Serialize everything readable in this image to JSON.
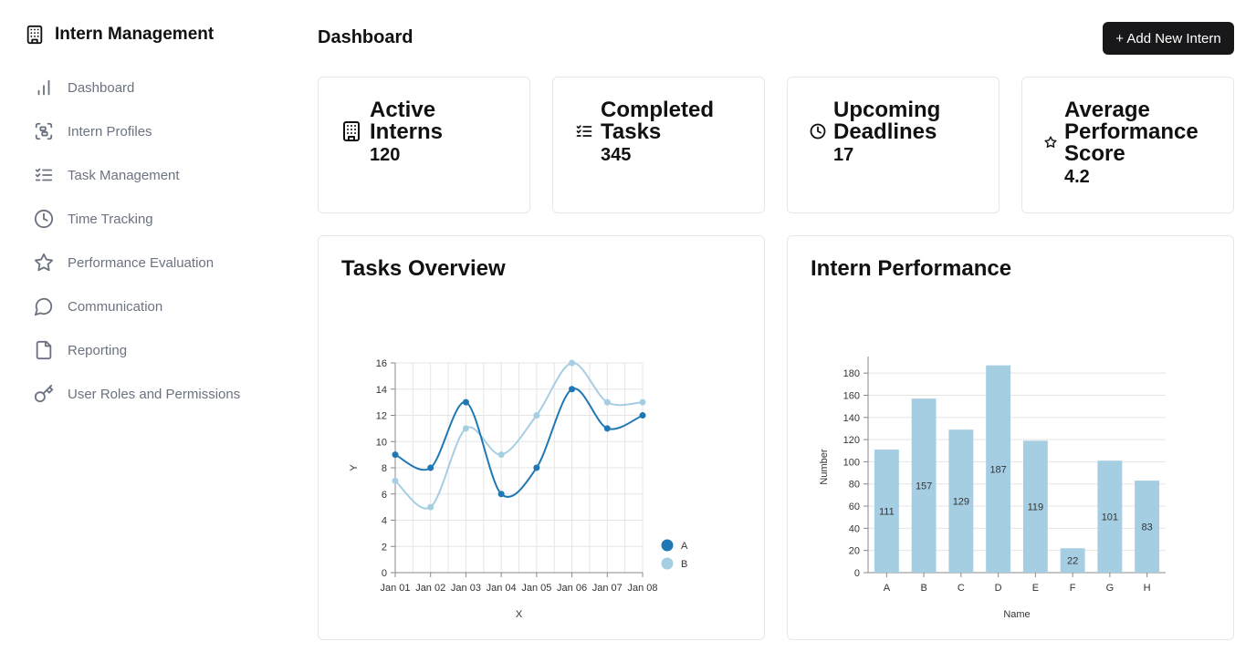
{
  "app": {
    "title": "Intern Management",
    "logo_icon": "building-icon"
  },
  "nav": [
    {
      "label": "Dashboard",
      "icon": "bar-chart-icon"
    },
    {
      "label": "Intern Profiles",
      "icon": "scan-face-icon"
    },
    {
      "label": "Task Management",
      "icon": "list-checks-icon"
    },
    {
      "label": "Time Tracking",
      "icon": "clock-icon"
    },
    {
      "label": "Performance Evaluation",
      "icon": "star-icon"
    },
    {
      "label": "Communication",
      "icon": "message-circle-icon"
    },
    {
      "label": "Reporting",
      "icon": "file-icon"
    },
    {
      "label": "User Roles and Permissions",
      "icon": "key-icon"
    }
  ],
  "header": {
    "title": "Dashboard",
    "add_button": "+ Add New Intern"
  },
  "stats": [
    {
      "label_lines": [
        "Active",
        "Interns"
      ],
      "value": "120",
      "icon": "building-icon"
    },
    {
      "label_lines": [
        "Completed",
        "Tasks"
      ],
      "value": "345",
      "icon": "list-checks-icon"
    },
    {
      "label_lines": [
        "Upcoming",
        "Deadlines"
      ],
      "value": "17",
      "icon": "clock-icon"
    },
    {
      "label_lines": [
        "Average",
        "Performance",
        "Score"
      ],
      "value": "4.2",
      "icon": "star-icon"
    }
  ],
  "colors": {
    "series_a": "#1f77b4",
    "series_b": "#a6cee3",
    "bar": "#a6cee3",
    "button_bg": "#18181b"
  },
  "chart_data": [
    {
      "type": "line",
      "title": "Tasks Overview",
      "xlabel": "X",
      "ylabel": "Y",
      "x": [
        "Jan 01",
        "Jan 02",
        "Jan 03",
        "Jan 04",
        "Jan 05",
        "Jan 06",
        "Jan 07",
        "Jan 08"
      ],
      "ylim": [
        0,
        16
      ],
      "yticks": [
        0,
        2,
        4,
        6,
        8,
        10,
        12,
        14,
        16
      ],
      "grid": true,
      "legend": "bottom-right",
      "series": [
        {
          "name": "A",
          "values": [
            9,
            8,
            13,
            6,
            8,
            14,
            11,
            12
          ]
        },
        {
          "name": "B",
          "values": [
            7,
            5,
            11,
            9,
            12,
            16,
            13,
            13
          ]
        }
      ]
    },
    {
      "type": "bar",
      "title": "Intern Performance",
      "xlabel": "Name",
      "ylabel": "Number",
      "categories": [
        "A",
        "B",
        "C",
        "D",
        "E",
        "F",
        "G",
        "H"
      ],
      "values": [
        111,
        157,
        129,
        187,
        119,
        22,
        101,
        83
      ],
      "ylim": [
        0,
        190
      ],
      "yticks": [
        0,
        20,
        40,
        60,
        80,
        100,
        120,
        140,
        160,
        180
      ],
      "grid": true
    }
  ]
}
